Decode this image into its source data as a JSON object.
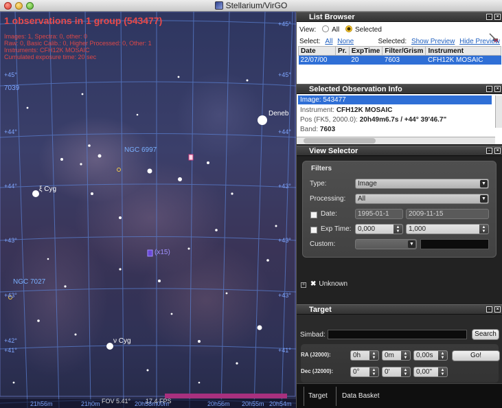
{
  "window": {
    "title": "Stellarium/VirGO"
  },
  "sky": {
    "obs_title": "1 observations in 1 group (543477)",
    "lines": [
      "Images: 1, Spectra: 0, other: 0",
      "Raw: 0, Basic Calib.: 0, Higher Processed: 0, Other: 1",
      "Instruments: CFH12K MOSAIC",
      "Cumulated exposure time: 20 sec"
    ],
    "dec_labels": [
      "+45°",
      "+45°",
      "+45°",
      "+44°",
      "+44°",
      "+44°",
      "+43°",
      "+43°",
      "+43°",
      "+43°",
      "+43°",
      "+42°",
      "+41°",
      "+41°"
    ],
    "ra_top": "7039",
    "objects": {
      "ngc6997": "NGC 6997",
      "ngc7027": "NGC 7027",
      "cluster": "(x15)"
    },
    "stars": {
      "deneb": "Deneb",
      "xi_cyg": "ξ Cyg",
      "nu_cyg": "ν Cyg"
    },
    "status": {
      "fov": "FOV 5.41°",
      "fps": "17.4 FPS",
      "ra_ticks": [
        "21h56m",
        "21h0m",
        "20h58m00m",
        "20h56m",
        "20h55m",
        "20h54m"
      ]
    }
  },
  "list_browser": {
    "title": "List Browser",
    "view_label": "View:",
    "opt_all": "All",
    "opt_selected": "Selected",
    "select_label": "Select:",
    "select_all": "All",
    "select_none": "None",
    "selected_label": "Selected:",
    "show_preview": "Show Preview",
    "hide_preview": "Hide Preview",
    "columns": [
      "Date",
      "Pr.",
      "ExpTime",
      "Filter/Grism",
      "Instrument"
    ],
    "rows": [
      {
        "date": "22/07/00",
        "pr": "",
        "exptime": "20",
        "filter": "7603",
        "instrument": "CFH12K MOSAIC"
      }
    ]
  },
  "obs_info": {
    "title": "Selected Observation Info",
    "image_label": "Image:",
    "image_value": "543477",
    "instrument_label": "Instrument:",
    "instrument_value": "CFH12K MOSAIC",
    "pos_label": "Pos (FK5, 2000.0):",
    "pos_value": "20h49m6.7s / +44° 39'46.7\"",
    "band_label": "Band:",
    "band_value": "7603"
  },
  "view_selector": {
    "title": "View Selector",
    "filters_label": "Filters",
    "type_label": "Type:",
    "type_value": "Image",
    "processing_label": "Processing:",
    "processing_value": "All",
    "date_label": "Date:",
    "date_from": "1995-01-1",
    "date_to": "2009-11-15",
    "exp_label": "Exp Time:",
    "exp_from": "0,000",
    "exp_to": "1,000",
    "custom_label": "Custom:",
    "custom_value": "",
    "tree_item": "Unknown"
  },
  "target": {
    "title": "Target",
    "simbad_label": "Simbad:",
    "search_btn": "Search",
    "ra_label": "RA (J2000):",
    "ra_h": "0h",
    "ra_m": "0m",
    "ra_s": "0,00s",
    "go_btn": "Go!",
    "dec_label": "Dec (J2000):",
    "dec_d": "0°",
    "dec_m": "0'",
    "dec_s": "0,00\""
  },
  "tabs": {
    "target": "Target",
    "basket": "Data Basket"
  }
}
